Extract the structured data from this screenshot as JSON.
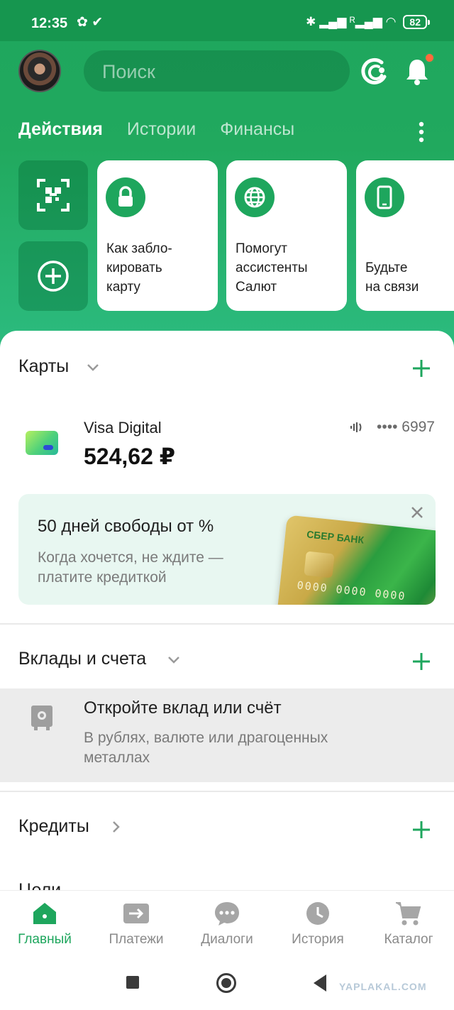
{
  "status_bar": {
    "time": "12:35",
    "left_icons": "✿ ✔",
    "right_icons": "✱ ▂▄▆ ᴿ▂▄▆ ◠",
    "battery": "82"
  },
  "header": {
    "search_placeholder": "Поиск",
    "tabs": [
      {
        "label": "Действия"
      },
      {
        "label": "Истории"
      },
      {
        "label": "Финансы"
      }
    ]
  },
  "stories": [
    {
      "text": "Как забло-\nкировать\nкарту",
      "icon": "lock-icon"
    },
    {
      "text": "Помогут\nассистенты\nСалют",
      "icon": "globe-icon"
    },
    {
      "text": "Будьте\nна связи",
      "icon": "phone-icon"
    }
  ],
  "cards_section": {
    "title": "Карты",
    "card": {
      "name": "Visa Digital",
      "balance": "524,62 ₽",
      "number": "•••• 6997"
    }
  },
  "promo": {
    "title": "50 дней свободы от %",
    "description": "Когда хочется, не ждите — платите кредиткой",
    "card_brand": "СБЕР БАНК",
    "card_number": "0000 0000 0000"
  },
  "deposits_section": {
    "title": "Вклады и счета",
    "empty_title": "Откройте вклад или счёт",
    "empty_desc": "В рублях, валюте или драгоценных металлах"
  },
  "credits_section": {
    "title": "Кредиты"
  },
  "goals_section": {
    "title": "Цели"
  },
  "bottom_nav": [
    {
      "label": "Главный",
      "icon": "home-icon",
      "active": true
    },
    {
      "label": "Платежи",
      "icon": "transfer-icon",
      "active": false
    },
    {
      "label": "Диалоги",
      "icon": "chat-icon",
      "active": false
    },
    {
      "label": "История",
      "icon": "clock-icon",
      "active": false
    },
    {
      "label": "Каталог",
      "icon": "cart-icon",
      "active": false
    }
  ],
  "watermark": "YAPLAKAL.COM",
  "colors": {
    "brand_green": "#1ea65d",
    "notification_dot": "#ff6a3d"
  }
}
